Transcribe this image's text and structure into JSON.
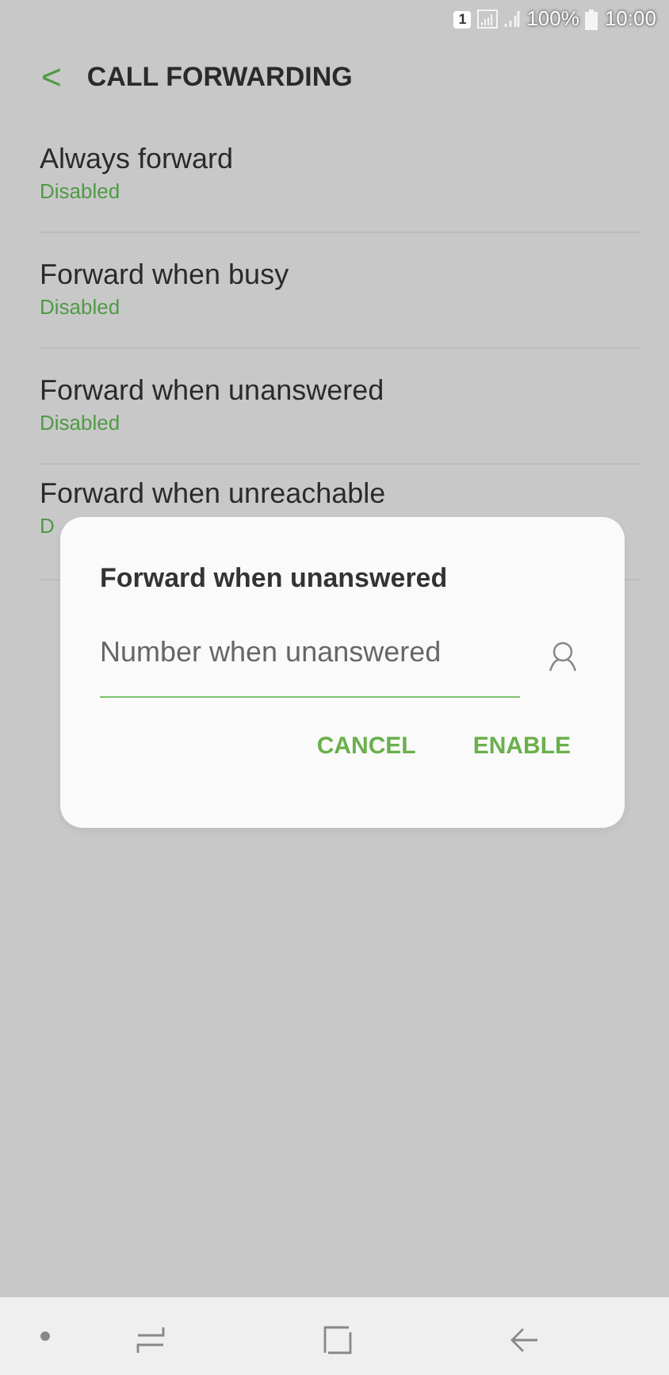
{
  "status_bar": {
    "sim": "1",
    "battery_text": "100%",
    "time": "10:00"
  },
  "header": {
    "back": "<",
    "title": "CALL FORWARDING"
  },
  "items": [
    {
      "title": "Always forward",
      "subtitle": "Disabled"
    },
    {
      "title": "Forward when busy",
      "subtitle": "Disabled"
    },
    {
      "title": "Forward when unanswered",
      "subtitle": "Disabled"
    },
    {
      "title": "Forward when unreachable",
      "subtitle": "D"
    }
  ],
  "dialog": {
    "title": "Forward when unanswered",
    "placeholder": "Number when unanswered",
    "buttons": [
      "CANCEL",
      "ENABLE"
    ]
  }
}
